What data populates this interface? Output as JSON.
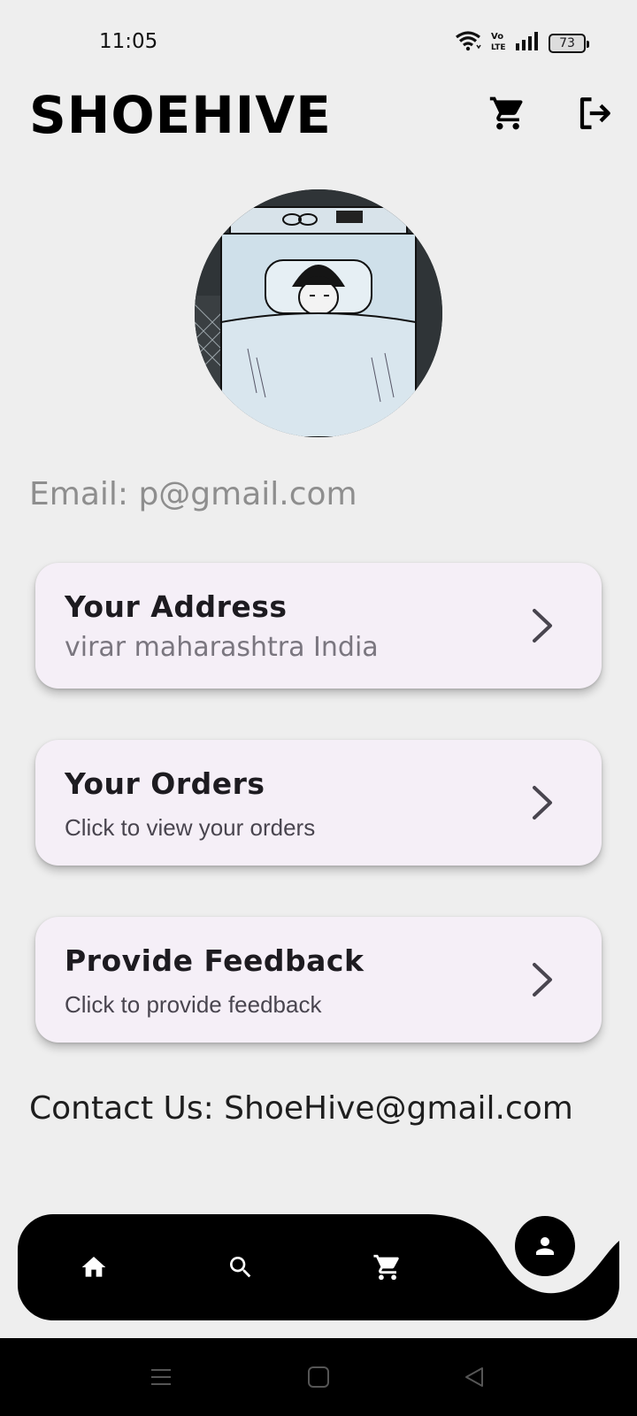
{
  "status_bar": {
    "time": "11:05",
    "battery": "73",
    "icons": [
      "wifi-icon",
      "volte-icon",
      "signal-icon",
      "battery-icon"
    ]
  },
  "header": {
    "title": "SHOEHIVE",
    "icons": [
      "cart-icon",
      "logout-icon"
    ]
  },
  "profile": {
    "avatar": "avatar-image",
    "email_text": "Email: p@gmail.com"
  },
  "cards": [
    {
      "title": "Your Address",
      "subtitle": "virar maharashtra India"
    },
    {
      "title": "Your Orders",
      "subtitle": "Click to view your orders"
    },
    {
      "title": "Provide Feedback",
      "subtitle": "Click to provide feedback"
    }
  ],
  "contact_text": "Contact Us: ShoeHive@gmail.com",
  "bottom_nav": {
    "items": [
      "home-icon",
      "search-icon",
      "cart-icon",
      "person-icon"
    ],
    "active": "person-icon"
  },
  "colors": {
    "background": "#eeeeee",
    "card": "#f5eff7",
    "nav": "#000000",
    "email": "#8e8e8e"
  }
}
